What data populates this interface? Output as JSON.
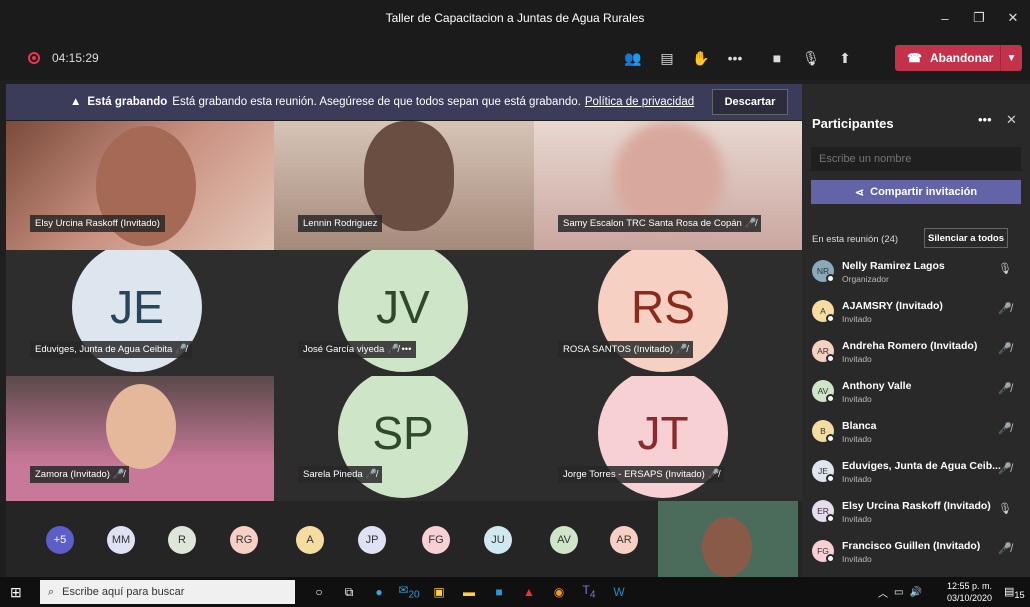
{
  "window": {
    "title": "Taller de Capacitacion a Juntas de Agua Rurales",
    "minimize": "–",
    "maximize": "❐",
    "close": "✕"
  },
  "toolbar": {
    "timer": "04:15:29",
    "leave_label": "Abandonar",
    "icons": [
      "people-icon",
      "chat-icon",
      "raise-hand-icon",
      "more-icon",
      "camera-icon",
      "mic-icon",
      "share-icon"
    ]
  },
  "banner": {
    "strong": "Está grabando",
    "text": "Está grabando esta reunión. Asegúrese de que todos sepan que está grabando.",
    "link": "Política de privacidad",
    "dismiss": "Descartar"
  },
  "tiles": [
    {
      "label": "Elsy Urcina Raskoff (Invitado)"
    },
    {
      "label": "Lennin Rodriguez"
    },
    {
      "label": "Samy Escalon TRC Santa Rosa de Copán"
    },
    {
      "label": "Eduviges, Junta de Agua Ceibita",
      "initials": "JE"
    },
    {
      "label": "José García viyeda",
      "initials": "JV"
    },
    {
      "label": "ROSA SANTOS (Invitado)",
      "initials": "RS"
    },
    {
      "label": "Zamora (Invitado)"
    },
    {
      "label": "Sarela Pineda",
      "initials": "SP"
    },
    {
      "label": "Jorge Torres - ERSAPS (Invitado)",
      "initials": "JT"
    }
  ],
  "strip": [
    "+5",
    "MM",
    "R",
    "RG",
    "A",
    "JP",
    "FG",
    "JU",
    "AV",
    "AR"
  ],
  "panel": {
    "title": "Participantes",
    "search_placeholder": "Escribe un nombre",
    "invite": "Compartir invitación",
    "in_meeting": "En esta reunión (24)",
    "mute_all": "Silenciar a todos",
    "participants": [
      {
        "initials": "NR",
        "name": "Nelly Ramirez Lagos",
        "role": "Organizador",
        "color": "#8ab"
      },
      {
        "initials": "A",
        "name": "AJAMSRY (Invitado)",
        "role": "Invitado",
        "color": "#f5dca0"
      },
      {
        "initials": "AR",
        "name": "Andreha Romero (Invitado)",
        "role": "Invitado",
        "color": "#f7d0c4"
      },
      {
        "initials": "AV",
        "name": "Anthony Valle",
        "role": "Invitado",
        "color": "#cfe5c8"
      },
      {
        "initials": "B",
        "name": "Blanca",
        "role": "Invitado",
        "color": "#f5dca0"
      },
      {
        "initials": "JE",
        "name": "Eduviges, Junta de Agua Ceib...",
        "role": "Invitado",
        "color": "#dde6ee"
      },
      {
        "initials": "ER",
        "name": "Elsy Urcina Raskoff (Invitado)",
        "role": "Invitado",
        "color": "#e6dcee"
      },
      {
        "initials": "FG",
        "name": "Francisco Guillen (Invitado)",
        "role": "Invitado",
        "color": "#f7d0d4"
      }
    ]
  },
  "taskbar": {
    "search": "Escribe aquí para buscar",
    "time": "12:55 p. m.",
    "date": "03/10/2020",
    "badge_a": "20",
    "badge_b": "4",
    "notif": "15"
  }
}
